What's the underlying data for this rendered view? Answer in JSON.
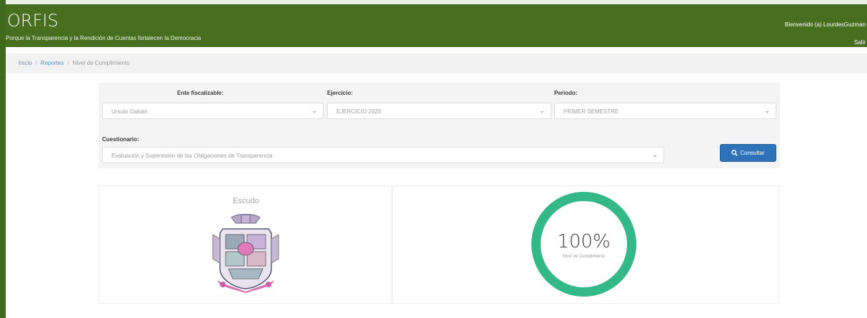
{
  "header": {
    "brand": "ORFIS",
    "tagline": "Porque la Transparencia y la Rendición de Cuentas fortalecen la Democracia",
    "welcome": "Bienvenido (a) LourdesGuzman",
    "logout": "Salir"
  },
  "breadcrumb": {
    "items": [
      "Inicio",
      "Reportes",
      "Nivel de Cumplimiento"
    ]
  },
  "filters": {
    "ente_label": "Ente fiscalizable:",
    "ente_value": "Ursulo Galván",
    "ejercicio_label": "Ejercicio:",
    "ejercicio_value": "EJERCICIO 2020",
    "periodo_label": "Periodo:",
    "periodo_value": "PRIMER SEMESTRE",
    "cuestionario_label": "Cuestionario:",
    "cuestionario_value": "Evaluación y Supervisión de las Obligaciones de Transparencia",
    "consult_button": "Consultar"
  },
  "results": {
    "escudo_title": "Escudo",
    "compliance_value": "100%",
    "compliance_fraction": 1.0,
    "compliance_label": "Nivel de Cumplimiento"
  },
  "colors": {
    "header_green": "#476f1f",
    "ring_green": "#35b889",
    "button_blue": "#2f72b9"
  },
  "icons": {
    "select_chevron": "chevron-down-icon",
    "consult": "search-icon"
  }
}
